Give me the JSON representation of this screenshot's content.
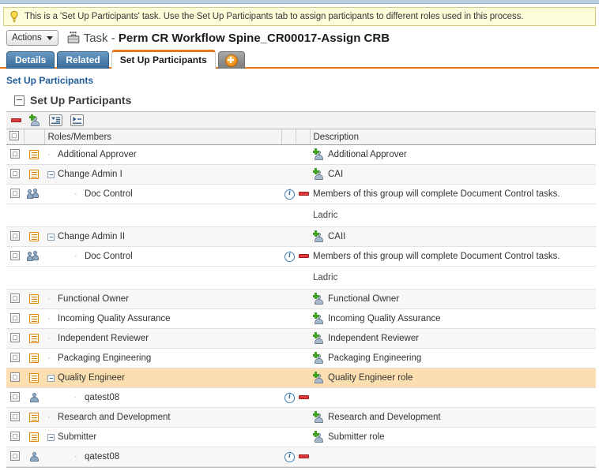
{
  "tip": {
    "icon": "lightbulb-icon",
    "text": "This is a 'Set Up Participants' task. Use the Set Up Participants tab to assign participants to different roles used in this process."
  },
  "toolbar": {
    "actions_label": "Actions",
    "task_prefix": "Task - ",
    "task_title": "Perm CR Workflow Spine_CR00017-Assign CRB"
  },
  "tabs": [
    {
      "label": "Details",
      "active": false
    },
    {
      "label": "Related",
      "active": false
    },
    {
      "label": "Set Up Participants",
      "active": true
    },
    {
      "label": "",
      "active": false,
      "icon": "add-circle-icon"
    }
  ],
  "breadcrumb": "Set Up Participants",
  "section": {
    "title": "Set Up Participants"
  },
  "grid_toolbar": [
    {
      "name": "remove-button",
      "icon": "minus-icon"
    },
    {
      "name": "add-participant-button",
      "icon": "add-person-icon"
    },
    {
      "name": "collapse-all-button",
      "icon": "collapse-all-icon"
    },
    {
      "name": "expand-all-button",
      "icon": "expand-all-icon"
    }
  ],
  "columns": {
    "roles_members": "Roles/Members",
    "description": "Description"
  },
  "rows": [
    {
      "type": "role",
      "level": 1,
      "expander": "none",
      "name": "Additional Approver",
      "desc": "Additional Approver",
      "desc_icon": "add-person-icon",
      "info": false,
      "delete": false,
      "selected": false,
      "note": ""
    },
    {
      "type": "role",
      "level": 1,
      "expander": "collapse",
      "name": "Change Admin I",
      "desc": "CAI",
      "desc_icon": "add-person-icon",
      "info": false,
      "delete": false,
      "selected": false,
      "note": ""
    },
    {
      "type": "group",
      "level": 2,
      "expander": "none",
      "name": "Doc Control",
      "desc": "Members of this group will complete Document Control tasks.",
      "desc_icon": "",
      "info": true,
      "delete": true,
      "selected": false,
      "note": "Ladric"
    },
    {
      "type": "role",
      "level": 1,
      "expander": "collapse",
      "name": "Change Admin II",
      "desc": "CAII",
      "desc_icon": "add-person-icon",
      "info": false,
      "delete": false,
      "selected": false,
      "note": ""
    },
    {
      "type": "group",
      "level": 2,
      "expander": "none",
      "name": "Doc Control",
      "desc": "Members of this group will complete Document Control tasks.",
      "desc_icon": "",
      "info": true,
      "delete": true,
      "selected": false,
      "note": "Ladric"
    },
    {
      "type": "role",
      "level": 1,
      "expander": "none",
      "name": "Functional Owner",
      "desc": "Functional Owner",
      "desc_icon": "add-person-icon",
      "info": false,
      "delete": false,
      "selected": false,
      "note": ""
    },
    {
      "type": "role",
      "level": 1,
      "expander": "none",
      "name": "Incoming Quality Assurance",
      "desc": "Incoming Quality Assurance",
      "desc_icon": "add-person-icon",
      "info": false,
      "delete": false,
      "selected": false,
      "note": ""
    },
    {
      "type": "role",
      "level": 1,
      "expander": "none",
      "name": "Independent Reviewer",
      "desc": "Independent Reviewer",
      "desc_icon": "add-person-icon",
      "info": false,
      "delete": false,
      "selected": false,
      "note": ""
    },
    {
      "type": "role",
      "level": 1,
      "expander": "none",
      "name": "Packaging Engineering",
      "desc": "Packaging Engineering",
      "desc_icon": "add-person-icon",
      "info": false,
      "delete": false,
      "selected": false,
      "note": ""
    },
    {
      "type": "role",
      "level": 1,
      "expander": "collapse",
      "name": "Quality Engineer",
      "desc": "Quality Engineer role",
      "desc_icon": "add-person-icon",
      "info": false,
      "delete": false,
      "selected": true,
      "note": ""
    },
    {
      "type": "person",
      "level": 2,
      "expander": "none",
      "name": "qatest08",
      "desc": "",
      "desc_icon": "",
      "info": true,
      "delete": true,
      "selected": false,
      "note": ""
    },
    {
      "type": "role",
      "level": 1,
      "expander": "none",
      "name": "Research and Development",
      "desc": "Research and Development",
      "desc_icon": "add-person-icon",
      "info": false,
      "delete": false,
      "selected": false,
      "note": ""
    },
    {
      "type": "role",
      "level": 1,
      "expander": "collapse",
      "name": "Submitter",
      "desc": "Submitter role",
      "desc_icon": "add-person-icon",
      "info": false,
      "delete": false,
      "selected": false,
      "note": ""
    },
    {
      "type": "person",
      "level": 2,
      "expander": "none",
      "name": "qatest08",
      "desc": "",
      "desc_icon": "",
      "info": true,
      "delete": true,
      "selected": false,
      "note": ""
    }
  ],
  "colors": {
    "accent_orange": "#e8761a",
    "tab_blue": "#4d80ab",
    "selected_row": "#fbdfb1",
    "link_blue": "#1f5c99",
    "tip_bg": "#fdfcd8"
  }
}
